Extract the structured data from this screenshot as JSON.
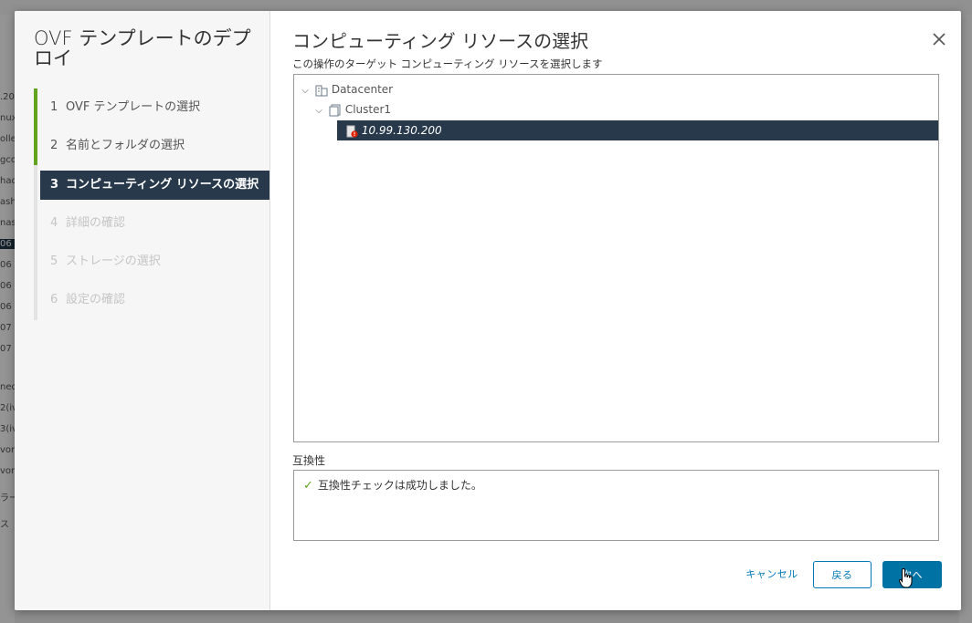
{
  "background": {
    "left_items": [
      ".20",
      "nux",
      "olle",
      "gco",
      "had",
      "ash",
      "nas",
      "06",
      "06",
      "06",
      "06",
      "07",
      "07",
      "ned",
      "2(iv",
      "3(iv",
      "vort",
      "vort",
      "ラー",
      "ス"
    ],
    "selected_index": 7
  },
  "dialog": {
    "nav_title": "OVF テンプレートのデプロイ",
    "steps": [
      {
        "num": "1",
        "label": "OVF テンプレートの選択",
        "state": "done"
      },
      {
        "num": "2",
        "label": "名前とフォルダの選択",
        "state": "done"
      },
      {
        "num": "3",
        "label": "コンピューティング リソースの選択",
        "state": "active"
      },
      {
        "num": "4",
        "label": "詳細の確認",
        "state": "disabled"
      },
      {
        "num": "5",
        "label": "ストレージの選択",
        "state": "disabled"
      },
      {
        "num": "6",
        "label": "設定の確認",
        "state": "disabled"
      }
    ],
    "title": "コンピューティング リソースの選択",
    "subtitle": "この操作のターゲット コンピューティング リソースを選択します",
    "tree": {
      "datacenter": "Datacenter",
      "cluster": "Cluster1",
      "host": "10.99.130.200"
    },
    "compatibility": {
      "label": "互換性",
      "message": "互換性チェックは成功しました。"
    },
    "buttons": {
      "cancel": "キャンセル",
      "back": "戻る",
      "next": "次へ"
    }
  },
  "colors": {
    "accent": "#0072a3",
    "nav_active": "#27394a",
    "progress": "#62a420"
  },
  "icons": [
    "close-icon",
    "chevron-down-icon",
    "datacenter-icon",
    "cluster-icon",
    "host-warning-icon",
    "checkmark-icon",
    "pointer-cursor-icon"
  ]
}
